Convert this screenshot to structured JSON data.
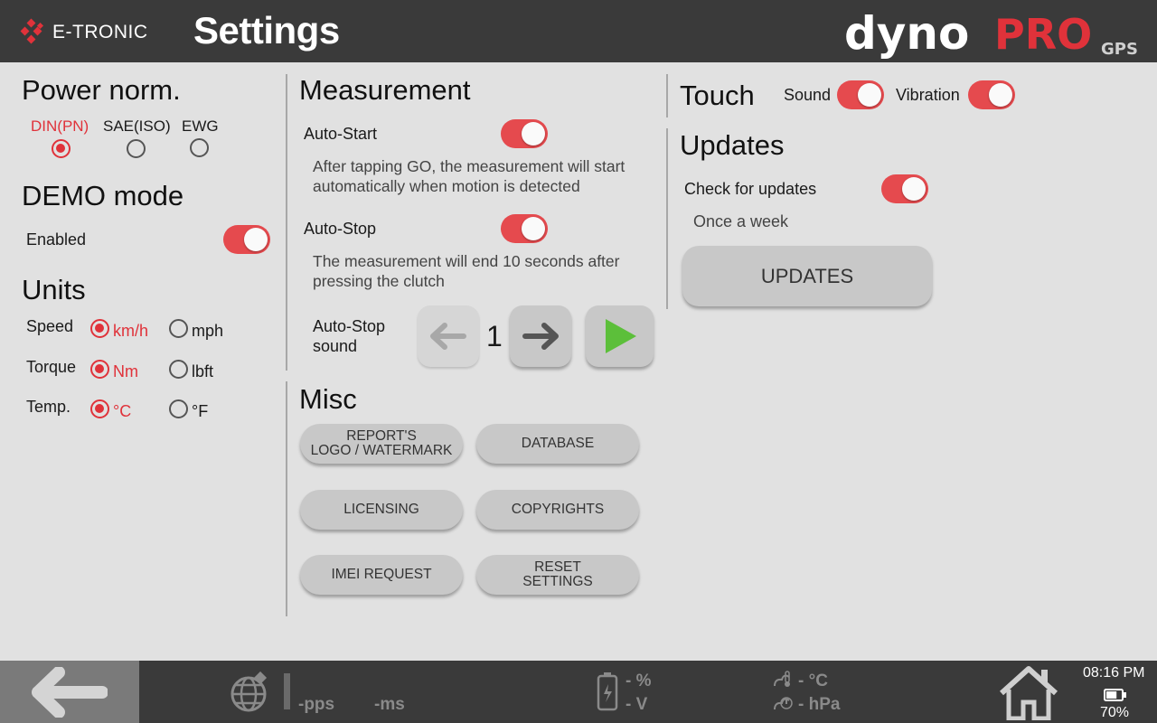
{
  "header": {
    "brand": "E-TRONIC",
    "title": "Settings",
    "product_logo": {
      "part1": "dyno",
      "part2": "PRO",
      "part3": "GPS"
    }
  },
  "power_norm": {
    "title": "Power norm.",
    "options": [
      {
        "label": "DIN(PN)",
        "selected": true
      },
      {
        "label": "SAE(ISO)",
        "selected": false
      },
      {
        "label": "EWG",
        "selected": false
      }
    ]
  },
  "demo_mode": {
    "title": "DEMO mode",
    "enabled_label": "Enabled",
    "enabled": true
  },
  "units": {
    "title": "Units",
    "rows": [
      {
        "label": "Speed",
        "opt1": "km/h",
        "opt2": "mph",
        "selected": 1
      },
      {
        "label": "Torque",
        "opt1": "Nm",
        "opt2": "lbft",
        "selected": 1
      },
      {
        "label": "Temp.",
        "opt1": "°C",
        "opt2": "°F",
        "selected": 1
      }
    ]
  },
  "measurement": {
    "title": "Measurement",
    "auto_start_label": "Auto-Start",
    "auto_start_on": true,
    "auto_start_desc_1": "After tapping GO, the measurement will start",
    "auto_start_desc_2": "automatically when motion is detected",
    "auto_stop_label": "Auto-Stop",
    "auto_stop_on": true,
    "auto_stop_desc_1": "The measurement will end 10 seconds after",
    "auto_stop_desc_2": "pressing the clutch",
    "sound_label_1": "Auto-Stop",
    "sound_label_2": "sound",
    "sound_value": "1"
  },
  "misc": {
    "title": "Misc",
    "buttons": {
      "report_logo_1": "REPORT'S",
      "report_logo_2": "LOGO / WATERMARK",
      "database": "DATABASE",
      "licensing": "LICENSING",
      "copyrights": "COPYRIGHTS",
      "imei": "IMEI REQUEST",
      "reset_1": "RESET",
      "reset_2": "SETTINGS"
    }
  },
  "touch": {
    "title": "Touch",
    "sound_label": "Sound",
    "sound_on": true,
    "vibration_label": "Vibration",
    "vibration_on": true
  },
  "updates": {
    "title": "Updates",
    "check_label": "Check for updates",
    "check_on": true,
    "frequency": "Once a week",
    "button": "UPDATES"
  },
  "footer": {
    "pps": "-pps",
    "ms": "-ms",
    "battery_pct": "- %",
    "battery_v": "- V",
    "temp": "- °C",
    "pressure": "- hPa",
    "time": "08:16 PM",
    "device_battery": "70%",
    "device_battery_level": 0.7
  },
  "colors": {
    "accent": "#e0323a",
    "header_bg": "#3a3a3a",
    "panel_bg": "#e1e1e1",
    "go_green": "#5cbf3a"
  }
}
